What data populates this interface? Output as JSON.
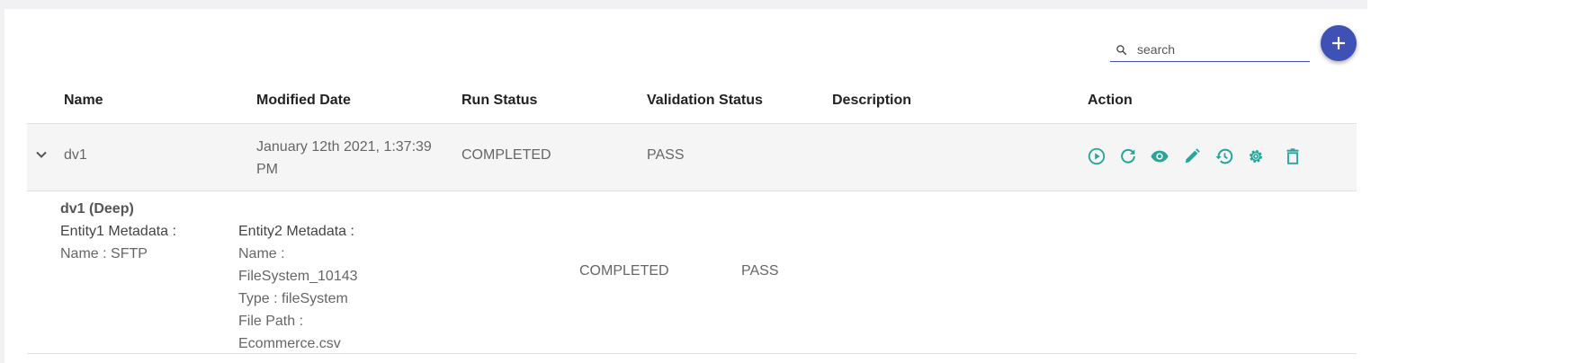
{
  "search": {
    "placeholder": "search"
  },
  "columns": [
    "Name",
    "Modified Date",
    "Run Status",
    "Validation Status",
    "Description",
    "Action"
  ],
  "row": {
    "name": "dv1",
    "modified_date": "January 12th 2021, 1:37:39 PM",
    "run_status": "COMPLETED",
    "validation_status": "PASS",
    "description": ""
  },
  "actions": [
    "run",
    "refresh",
    "view",
    "edit",
    "history",
    "settings",
    "delete"
  ],
  "detail": {
    "title": "dv1 (Deep)",
    "entity1_heading": "Entity1 Metadata :",
    "entity1_lines": [
      "Name : SFTP"
    ],
    "entity2_heading": "Entity2 Metadata :",
    "entity2_lines": [
      "Name :",
      "FileSystem_10143",
      "Type : fileSystem",
      "File Path :",
      "Ecommerce.csv"
    ],
    "run_status": "COMPLETED",
    "validation_status": "PASS"
  },
  "colors": {
    "accent": "#3f51b5",
    "action_icon": "#26a69a"
  }
}
